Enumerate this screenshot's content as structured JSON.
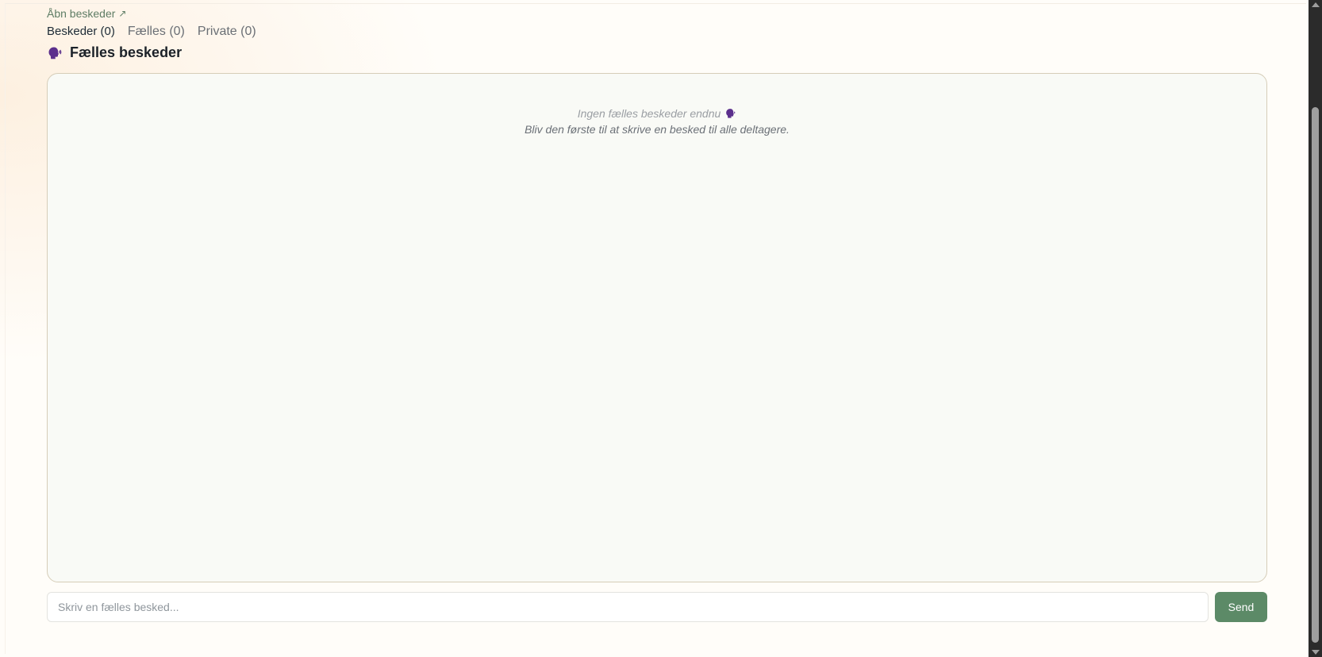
{
  "header": {
    "open_link_label": "Åbn beskeder",
    "open_link_icon": "external-arrow-icon"
  },
  "tabs": [
    {
      "label": "Beskeder (0)",
      "active": true
    },
    {
      "label": "Fælles (0)",
      "active": false
    },
    {
      "label": "Private (0)",
      "active": false
    }
  ],
  "section": {
    "title": "Fælles beskeder",
    "icon": "speaking-head-icon"
  },
  "chat": {
    "empty_title": "Ingen fælles beskeder endnu",
    "empty_subtitle": "Bliv den første til at skrive en besked til alle deltagere."
  },
  "composer": {
    "placeholder": "Skriv en fælles besked...",
    "value": "",
    "send_label": "Send"
  },
  "colors": {
    "accent": "#5c8a67",
    "link": "#5f7d65",
    "panel_border": "#d6cdb8",
    "panel_bg": "#f9faf6",
    "icon_purple": "#5b2f8c"
  }
}
